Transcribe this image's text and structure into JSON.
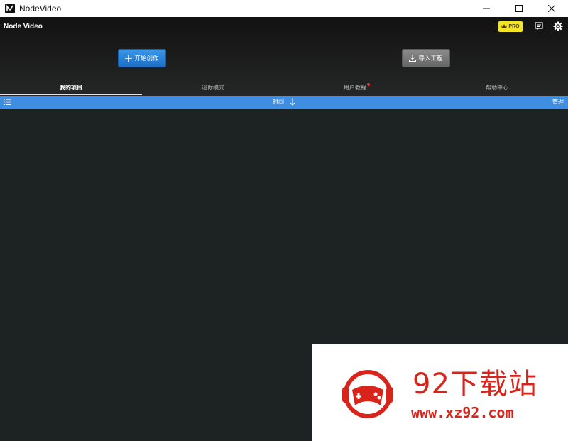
{
  "window": {
    "title": "NodeVideo",
    "controls": [
      "minimize",
      "maximize",
      "close"
    ]
  },
  "header": {
    "brand": "Node Video",
    "pro_label": "PRO",
    "icons": [
      "pro-crown-icon",
      "feedback-icon",
      "settings-gear-icon"
    ]
  },
  "actions": {
    "start_label": "开始创作",
    "import_label": "导入工程"
  },
  "tabs": [
    {
      "label": "我的项目",
      "active": true
    },
    {
      "label": "迷你模式",
      "active": false
    },
    {
      "label": "用户教程",
      "active": false,
      "badge": "red-dot"
    },
    {
      "label": "帮助中心",
      "active": false
    }
  ],
  "listbar": {
    "sort_label": "时间",
    "manage_label": "管理"
  },
  "watermark": {
    "title": "92下载站",
    "url": "www.xz92.com"
  },
  "colors": {
    "background": "#1d2222",
    "accent_blue": "#3f8ee2",
    "start_button": "#2a80d6",
    "import_button": "#777777",
    "pro_badge": "#f3e526",
    "tab_badge": "#e23a3a",
    "watermark_red": "#d9241c"
  }
}
